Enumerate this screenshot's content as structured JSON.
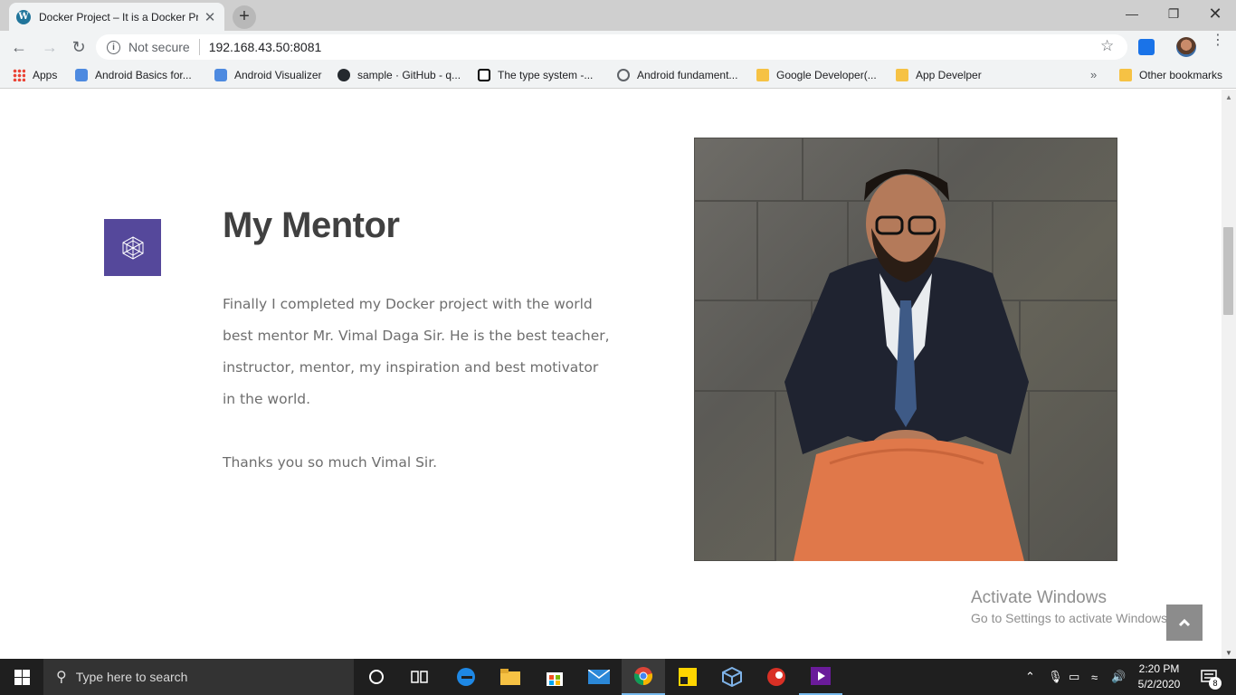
{
  "browser": {
    "tab_title": "Docker Project – It is a Docker Pr",
    "tab_close": "✕",
    "new_tab": "+",
    "security_label": "Not secure",
    "url": "192.168.43.50:8081"
  },
  "bookmarks": [
    {
      "label": "Apps",
      "icon": "apps-grid-icon"
    },
    {
      "label": "Android Basics for...",
      "icon": "android-icon"
    },
    {
      "label": "Android Visualizer",
      "icon": "android-icon"
    },
    {
      "label": "sample · GitHub - q...",
      "icon": "github-icon"
    },
    {
      "label": "The type system -...",
      "icon": "notion-icon"
    },
    {
      "label": "Android fundament...",
      "icon": "globe-icon"
    },
    {
      "label": "Google Developer(...",
      "icon": "folder-icon"
    },
    {
      "label": "App Develper",
      "icon": "folder-icon"
    },
    {
      "label": "Other bookmarks",
      "icon": "folder-icon"
    }
  ],
  "page": {
    "heading": "My Mentor",
    "paragraph": "Finally I completed my Docker project with the world best mentor Mr. Vimal Daga Sir. He is the best teacher, instructor, mentor, my inspiration and best motivator in the world.",
    "thanks": "Thanks you so much Vimal Sir.",
    "accent_color": "#55489b"
  },
  "watermark": {
    "title": "Activate Windows",
    "subtitle": "Go to Settings to activate Windows."
  },
  "taskbar": {
    "search_placeholder": "Type here to search",
    "time": "2:20 PM",
    "date": "5/2/2020",
    "notification_count": "8"
  }
}
